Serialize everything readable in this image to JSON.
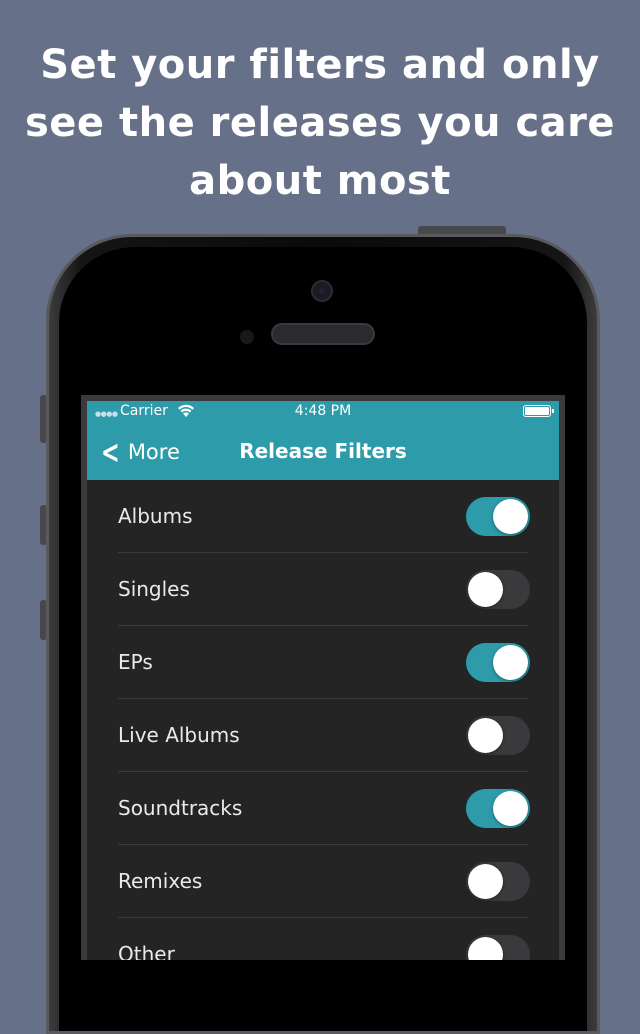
{
  "headline": {
    "line1": "Set your filters and only",
    "line2": "see the releases you care",
    "line3": "about most"
  },
  "status_bar": {
    "carrier": "Carrier",
    "time": "4:48 PM"
  },
  "nav": {
    "back_label": "More",
    "title": "Release Filters"
  },
  "filters": [
    {
      "label": "Albums",
      "enabled": true
    },
    {
      "label": "Singles",
      "enabled": false
    },
    {
      "label": "EPs",
      "enabled": true
    },
    {
      "label": "Live Albums",
      "enabled": false
    },
    {
      "label": "Soundtracks",
      "enabled": true
    },
    {
      "label": "Remixes",
      "enabled": false
    },
    {
      "label": "Other",
      "enabled": false
    }
  ],
  "colors": {
    "background": "#667089",
    "accent": "#2d9baa",
    "screen": "#242424"
  },
  "icons": {
    "back": "chevron-left-icon",
    "wifi": "wifi-icon",
    "battery": "battery-icon"
  }
}
